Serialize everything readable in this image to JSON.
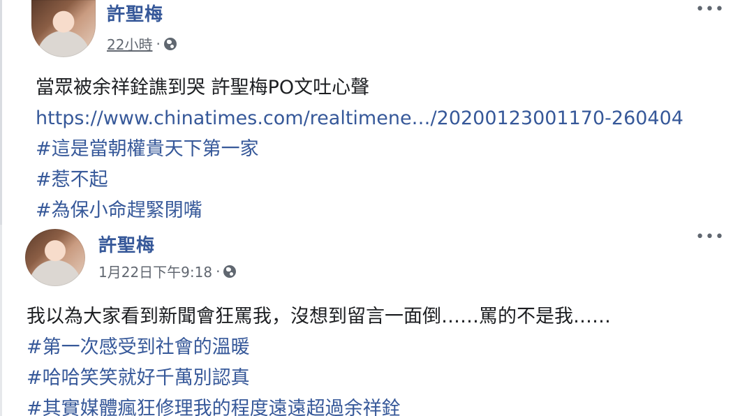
{
  "post1": {
    "author": "許聖梅",
    "time": "22小時",
    "separator": "·",
    "lines": [
      {
        "text": "當眾被余祥銓譙到哭 許聖梅PO文吐心聲",
        "kind": "text"
      },
      {
        "text": "https://www.chinatimes.com/realtimene…/20200123001170-260404",
        "kind": "link"
      },
      {
        "text": "#這是當朝權貴天下第一家",
        "kind": "tag"
      },
      {
        "text": "#惹不起",
        "kind": "tag"
      },
      {
        "text": "#為保小命趕緊閉嘴",
        "kind": "tag"
      }
    ],
    "more": "•••"
  },
  "post2": {
    "author": "許聖梅",
    "time": "1月22日下午9:18",
    "separator": "·",
    "lines": [
      {
        "text": "我以為大家看到新聞會狂罵我，沒想到留言一面倒……罵的不是我……",
        "kind": "text"
      },
      {
        "text": "#第一次感受到社會的溫暖",
        "kind": "tag"
      },
      {
        "text": "#哈哈笑笑就好千萬別認真",
        "kind": "tag"
      },
      {
        "text": "#其實媒體瘋狂修理我的程度遠遠超過余祥銓",
        "kind": "tag"
      }
    ],
    "more": "•••"
  },
  "icons": {
    "privacy": "globe-icon",
    "options": "more-icon"
  },
  "colors": {
    "link": "#365899",
    "text": "#1c1e21",
    "meta": "#616770"
  }
}
